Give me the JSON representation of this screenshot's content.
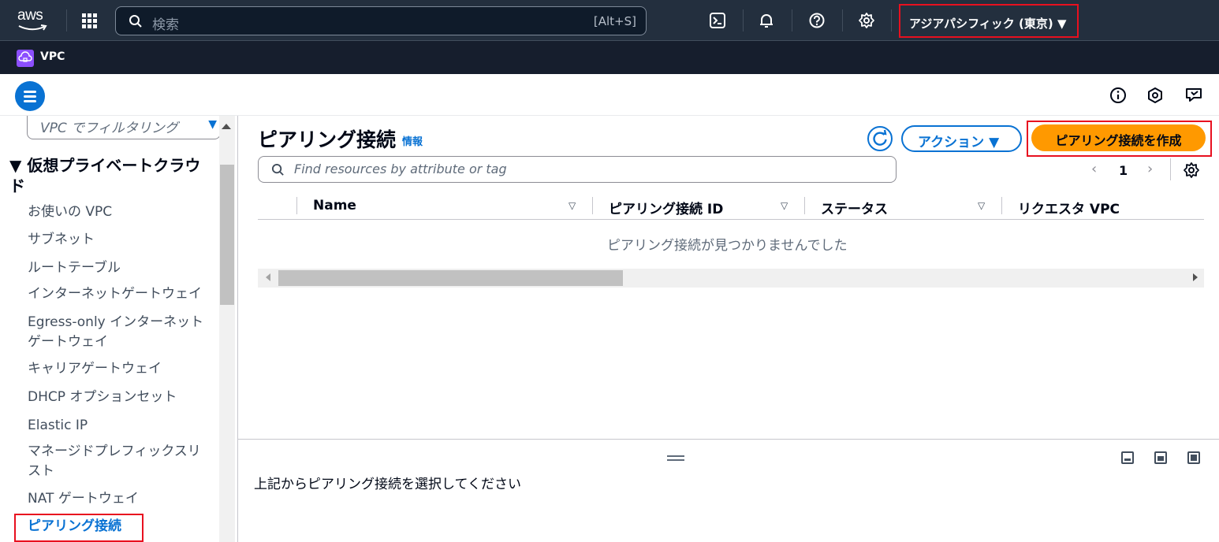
{
  "topnav": {
    "logo_text": "aws",
    "search_placeholder": "検索",
    "search_shortcut": "[Alt+S]",
    "icons": [
      "cloudshell-icon",
      "bell-icon",
      "help-icon",
      "gear-icon"
    ],
    "region": "アジアパシフィック (東京) ▼"
  },
  "service": {
    "name": "VPC"
  },
  "sidebar": {
    "filter_placeholder": "VPC でフィルタリング",
    "section_title": "▼ 仮想プライベートクラウド",
    "items": [
      "お使いの VPC",
      "サブネット",
      "ルートテーブル",
      "インターネットゲートウェイ",
      "Egress-only インターネットゲートウェイ",
      "キャリアゲートウェイ",
      "DHCP オプションセット",
      "Elastic IP",
      "マネージドプレフィックスリスト",
      "NAT ゲートウェイ",
      "ピアリング接続"
    ],
    "active_item": "ピアリング接続"
  },
  "main": {
    "title": "ピアリング接続",
    "info_link": "情報",
    "actions_label": "アクション ▼",
    "create_label": "ピアリング接続を作成",
    "search_placeholder": "Find resources by attribute or tag",
    "page_current": "1",
    "columns": [
      "Name",
      "ピアリング接続 ID",
      "ステータス",
      "リクエスタ VPC"
    ],
    "empty_message": "ピアリング接続が見つかりませんでした"
  },
  "split_panel": {
    "message": "上記からピアリング接続を選択してください"
  },
  "colors": {
    "nav_bg": "#232f3e",
    "service_bar": "#161e2d",
    "accent_blue": "#0972d3",
    "primary_orange": "#ff9900",
    "highlight_red": "#e8101f"
  }
}
